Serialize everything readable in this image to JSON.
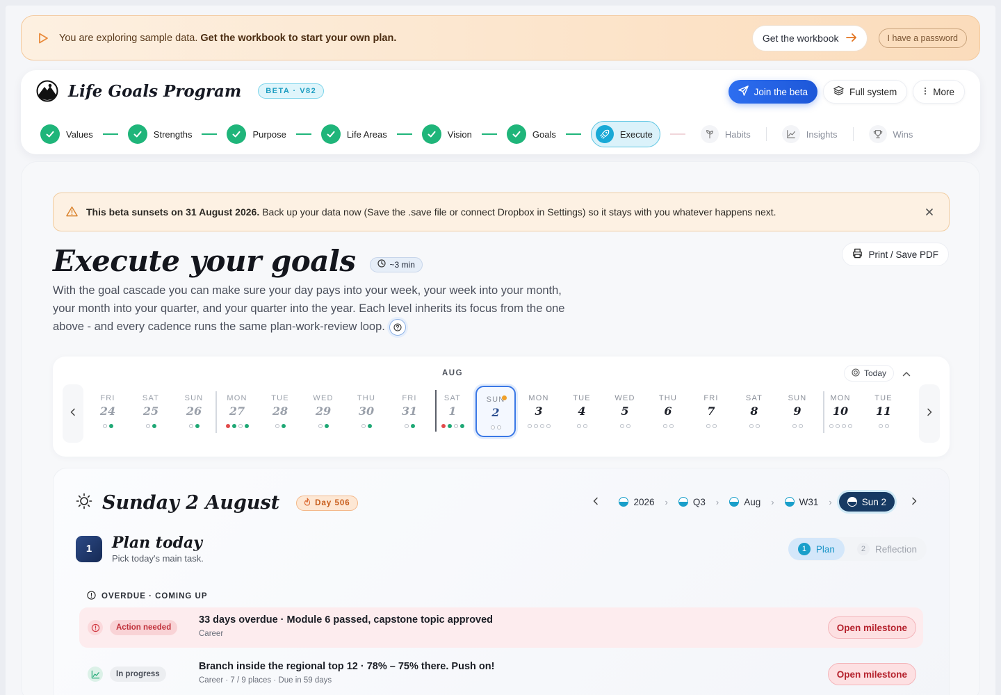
{
  "banner": {
    "text": "You are exploring sample data.",
    "bold_text": "Get the workbook to start your own plan.",
    "workbook_button": "Get the workbook",
    "password_button": "I have a password"
  },
  "header": {
    "brand_name": "Life Goals Program",
    "beta_badge": "BETA · V82",
    "join_beta": "Join the beta",
    "full_system": "Full system",
    "more": "More"
  },
  "steps": {
    "completed": [
      "Values",
      "Strengths",
      "Purpose",
      "Life Areas",
      "Vision",
      "Goals"
    ],
    "active": "Execute",
    "upcoming": [
      "Habits",
      "Insights",
      "Wins"
    ]
  },
  "notice": {
    "bold": "This beta sunsets on 31 August 2026.",
    "text": "Back up your data now (Save the .save file or connect Dropbox in Settings) so it stays with you whatever happens next."
  },
  "page": {
    "title": "Execute your goals",
    "duration": "~3 min",
    "print_button": "Print / Save PDF",
    "description": "With the goal cascade you can make sure your day pays into your week, your week into your month, your month into your quarter, and your quarter into the year. Each level inherits its focus from the one above - and every cadence runs the same plan-work-review loop."
  },
  "calendar": {
    "month_label": "AUG",
    "today_button": "Today",
    "days": [
      {
        "name": "FRI",
        "num": "24",
        "dots": [
          "o",
          "g"
        ],
        "past": true
      },
      {
        "name": "SAT",
        "num": "25",
        "dots": [
          "o",
          "g"
        ],
        "past": true
      },
      {
        "name": "SUN",
        "num": "26",
        "dots": [
          "o",
          "g"
        ],
        "past": true
      },
      {
        "name": "MON",
        "num": "27",
        "dots": [
          "r",
          "g",
          "o",
          "g"
        ],
        "past": true
      },
      {
        "name": "TUE",
        "num": "28",
        "dots": [
          "o",
          "g"
        ],
        "past": true
      },
      {
        "name": "WED",
        "num": "29",
        "dots": [
          "o",
          "g"
        ],
        "past": true
      },
      {
        "name": "THU",
        "num": "30",
        "dots": [
          "o",
          "g"
        ],
        "past": true
      },
      {
        "name": "FRI",
        "num": "31",
        "dots": [
          "o",
          "g"
        ],
        "past": true
      },
      {
        "name": "SAT",
        "num": "1",
        "dots": [
          "r",
          "g",
          "o",
          "g"
        ],
        "past": true
      },
      {
        "name": "SUN",
        "num": "2",
        "dots": [
          "o",
          "o"
        ],
        "past": false,
        "selected": true
      },
      {
        "name": "MON",
        "num": "3",
        "dots": [
          "o",
          "o",
          "o",
          "o"
        ],
        "past": false
      },
      {
        "name": "TUE",
        "num": "4",
        "dots": [
          "o",
          "o"
        ],
        "past": false
      },
      {
        "name": "WED",
        "num": "5",
        "dots": [
          "o",
          "o"
        ],
        "past": false
      },
      {
        "name": "THU",
        "num": "6",
        "dots": [
          "o",
          "o"
        ],
        "past": false
      },
      {
        "name": "FRI",
        "num": "7",
        "dots": [
          "o",
          "o"
        ],
        "past": false
      },
      {
        "name": "SAT",
        "num": "8",
        "dots": [
          "o",
          "o"
        ],
        "past": false
      },
      {
        "name": "SUN",
        "num": "9",
        "dots": [
          "o",
          "o"
        ],
        "past": false
      },
      {
        "name": "MON",
        "num": "10",
        "dots": [
          "o",
          "o",
          "o",
          "o"
        ],
        "past": false
      },
      {
        "name": "TUE",
        "num": "11",
        "dots": [
          "o",
          "o"
        ],
        "past": false
      }
    ]
  },
  "day": {
    "title": "Sunday 2 August",
    "badge": "Day 506",
    "crumbs": [
      "2026",
      "Q3",
      "Aug",
      "W31",
      "Sun 2"
    ],
    "plan_number": "1",
    "plan_title": "Plan today",
    "plan_subtitle": "Pick today's main task.",
    "tabs": [
      {
        "n": "1",
        "label": "Plan"
      },
      {
        "n": "2",
        "label": "Reflection"
      }
    ],
    "section_label": "OVERDUE · COMING UP",
    "rows": [
      {
        "tag": "Action needed",
        "title": "33 days overdue · Module 6 passed, capstone topic approved",
        "sub": "Career",
        "button": "Open milestone"
      },
      {
        "tag": "In progress",
        "title": "Branch inside the regional top 12 · 78% – 75% there. Push on!",
        "sub": "Career · 7 / 9 places · Due in 59 days",
        "button": "Open milestone"
      }
    ]
  },
  "colors": {
    "accent": "#19a9d6",
    "success": "#1fb57a",
    "danger": "#e14b4b",
    "primary": "#2d6ef0"
  }
}
